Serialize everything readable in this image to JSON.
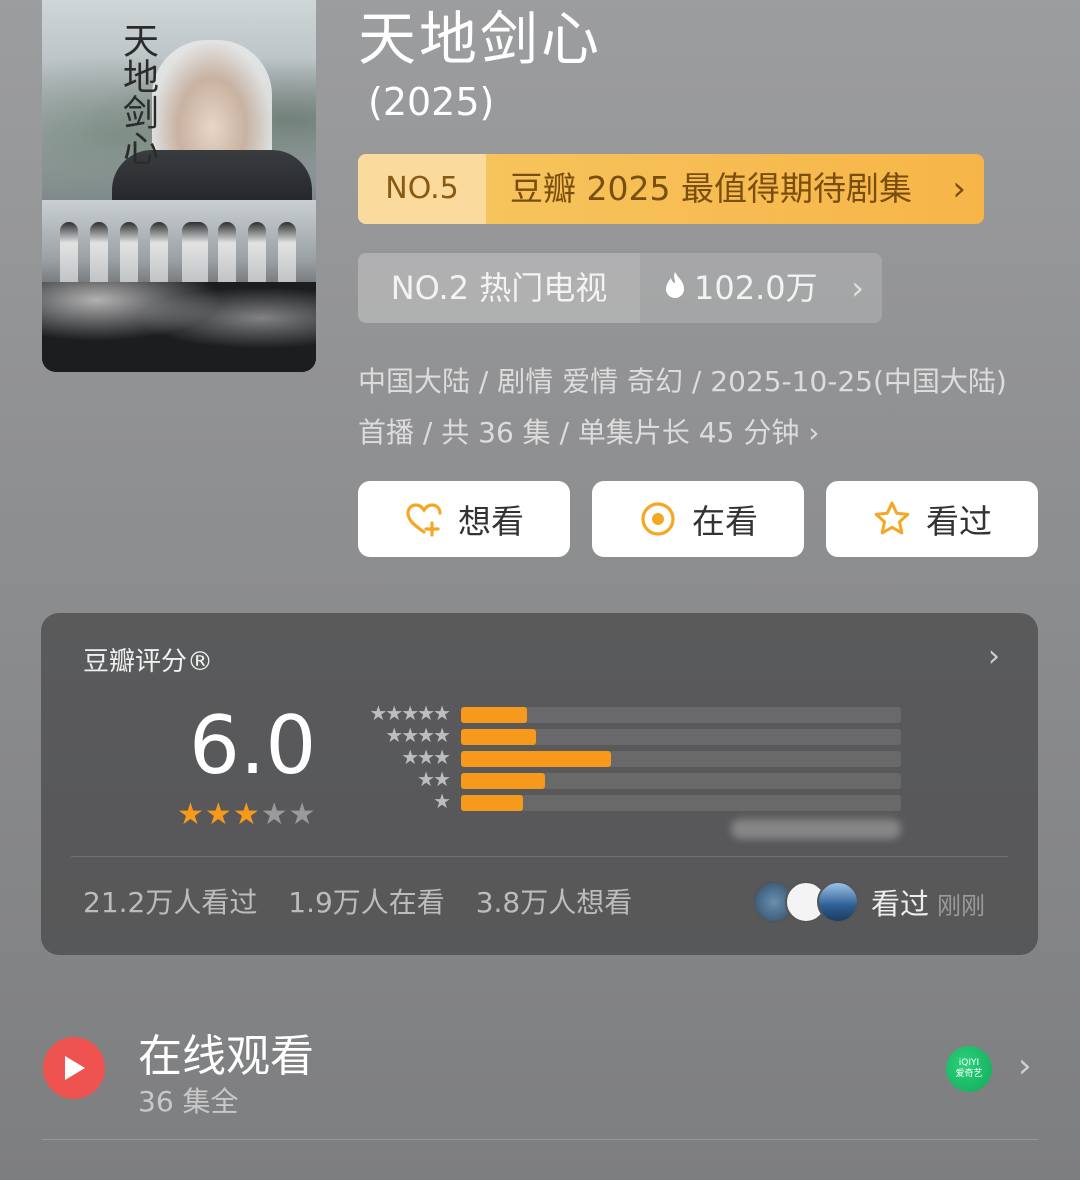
{
  "show": {
    "title": "天地剑心",
    "year": "(2025)",
    "poster_calligraphy": "天地剑心"
  },
  "rank_badge": {
    "no": "NO.5",
    "text": "豆瓣 2025 最值得期待剧集",
    "chevron": "›"
  },
  "hot_badge": {
    "text": "NO.2 热门电视",
    "heat": "102.0万",
    "chevron": "›"
  },
  "meta": {
    "line": "中国大陆 / 剧情 爱情 奇幻 / 2025-10-25(中国大陆) 首播 / 共 36 集 / 单集片长 45 分钟",
    "chevron": "›"
  },
  "actions": {
    "want": "想看",
    "watching": "在看",
    "watched": "看过"
  },
  "rating": {
    "header": "豆瓣评分®",
    "chevron": "›",
    "score": "6.0",
    "stars_filled": 3,
    "stars_total": 5,
    "distribution": [
      {
        "stars": 5,
        "fraction": 0.15
      },
      {
        "stars": 4,
        "fraction": 0.17
      },
      {
        "stars": 3,
        "fraction": 0.34
      },
      {
        "stars": 2,
        "fraction": 0.19
      },
      {
        "stars": 1,
        "fraction": 0.14
      }
    ],
    "stats": {
      "watched": "21.2万人看过",
      "watching": "1.9万人在看",
      "want": "3.8万人想看"
    },
    "friend_status": "看过",
    "friend_time": "刚刚"
  },
  "online": {
    "title": "在线观看",
    "episodes": "36 集全",
    "provider_logo_text_1": "iQIYI",
    "provider_logo_text_2": "爱奇艺",
    "chevron": "›"
  },
  "colors": {
    "accent_orange": "#f79a1b",
    "badge_gold": "#f6c761",
    "play_red": "#ef5350",
    "iqiyi_green": "#1fbf6b"
  }
}
